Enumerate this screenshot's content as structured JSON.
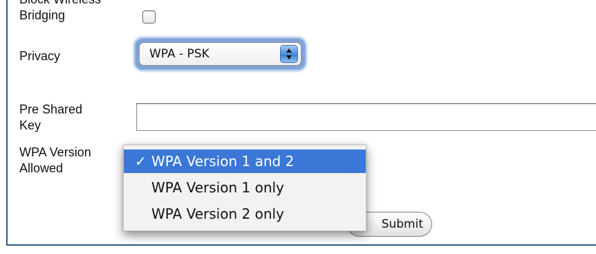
{
  "form": {
    "block_wireless_label": "Block Wireless\nBridging",
    "block_wireless_checked": false,
    "privacy_label": "Privacy",
    "privacy_value": "WPA - PSK",
    "psk_label": "Pre Shared\nKey",
    "psk_value": "",
    "wpa_version_label": "WPA Version\nAllowed",
    "submit_label": "Submit"
  },
  "dropdown": {
    "options": [
      {
        "label": "WPA Version 1 and 2",
        "selected": true,
        "check": "✓"
      },
      {
        "label": "WPA Version 1 only",
        "selected": false,
        "check": ""
      },
      {
        "label": "WPA Version 2 only",
        "selected": false,
        "check": ""
      }
    ]
  },
  "colors": {
    "frame_border": "#2b5a86",
    "selection_highlight": "#3a77d6",
    "focus_ring": "#7ea7de"
  }
}
